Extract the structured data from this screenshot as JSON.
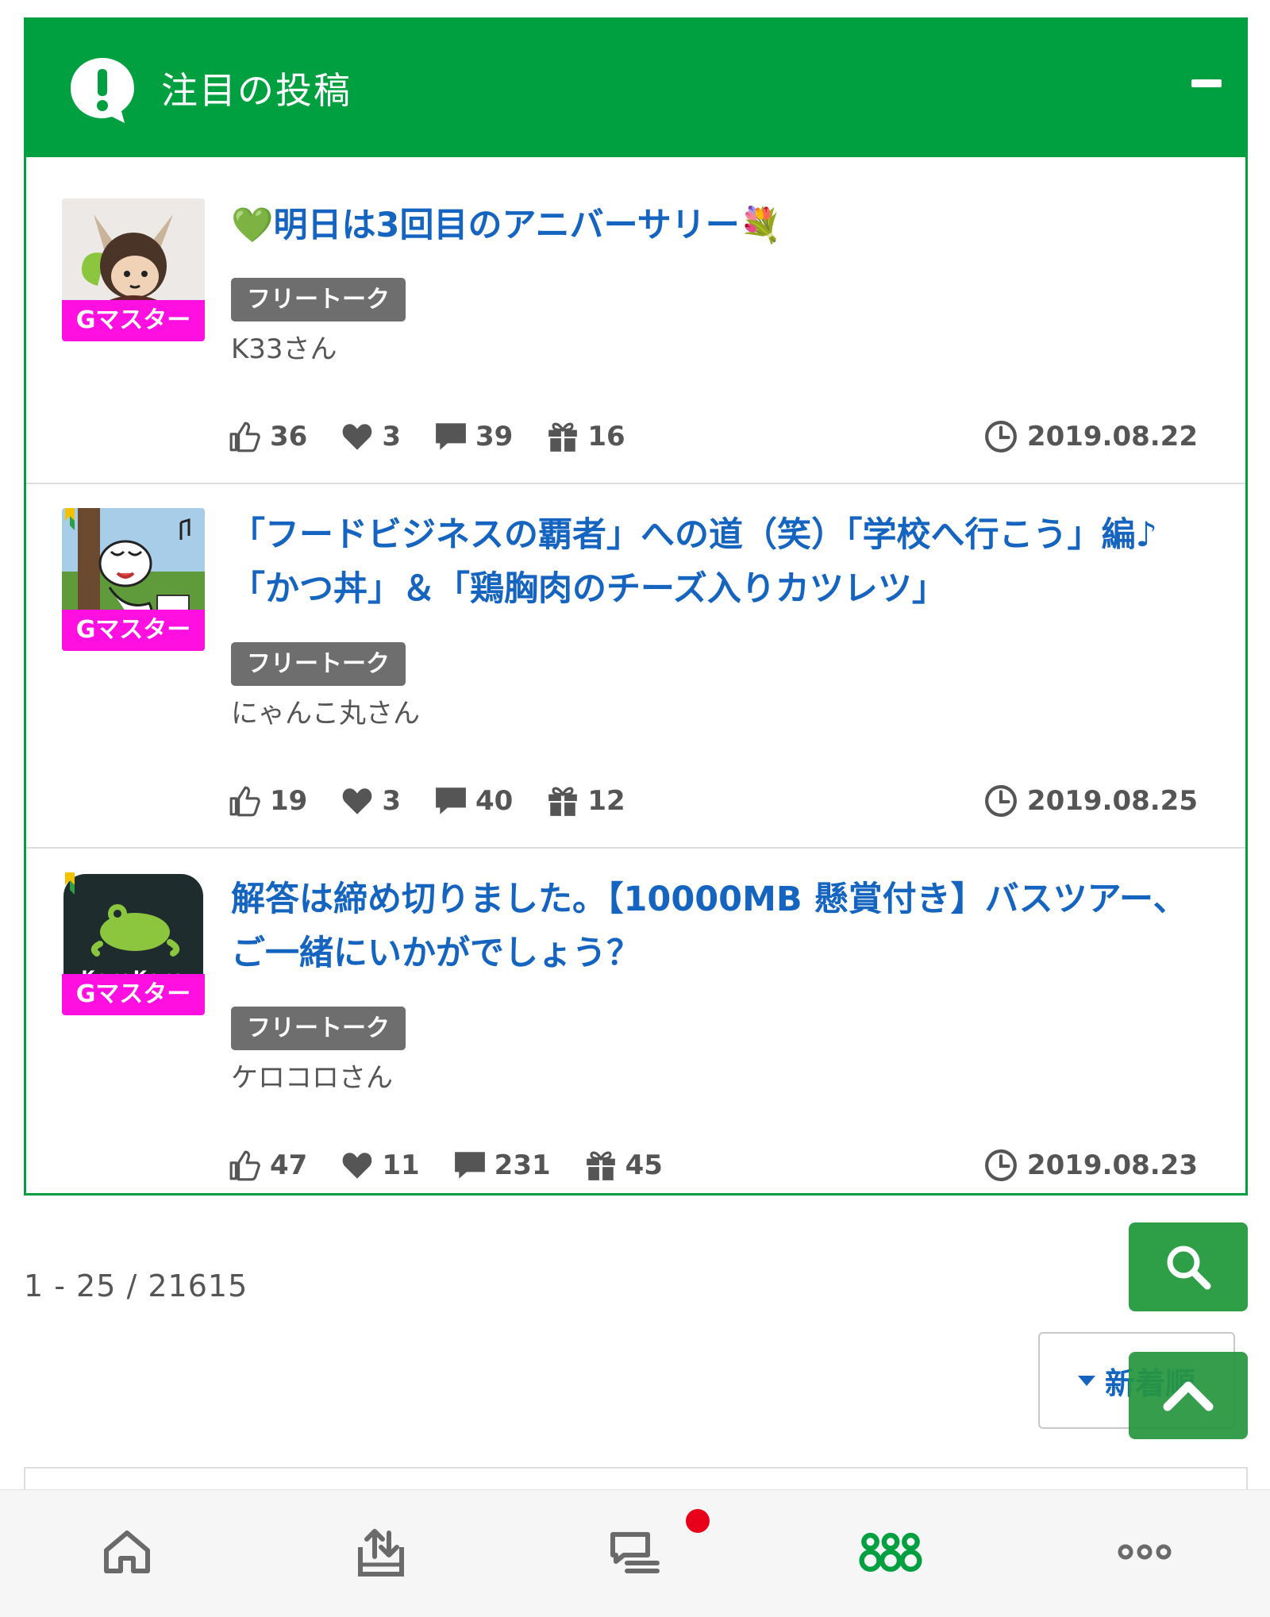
{
  "header": {
    "title": "注目の投稿"
  },
  "posts": [
    {
      "title": "💚明日は3回目のアニバーサリー💐",
      "badge": "Gマスター",
      "category": "フリートーク",
      "author": "K33さん",
      "likes": "36",
      "favorites": "3",
      "comments": "39",
      "gifts": "16",
      "date": "2019.08.22"
    },
    {
      "title": "「フードビジネスの覇者」への道（笑）「学校へ行こう」編♪「かつ丼」＆「鶏胸肉のチーズ入りカツレツ」",
      "badge": "Gマスター",
      "category": "フリートーク",
      "author": "にゃんこ丸さん",
      "likes": "19",
      "favorites": "3",
      "comments": "40",
      "gifts": "12",
      "date": "2019.08.25"
    },
    {
      "title": "解答は締め切りました。【10000MB 懸賞付き】バスツアー、ご一緒にいかがでしょう？",
      "badge": "Gマスター",
      "avatar_text": "KeroKoro",
      "category": "フリートーク",
      "author": "ケロコロさん",
      "likes": "47",
      "favorites": "11",
      "comments": "231",
      "gifts": "45",
      "date": "2019.08.23"
    }
  ],
  "pagination": {
    "range": "1 - 25 / 21615"
  },
  "sort": {
    "label": "新着順"
  },
  "icons": {
    "header": "exclamation-bubble-icon",
    "collapse": "minus-icon",
    "like": "thumbs-up-icon",
    "favorite": "heart-icon",
    "comment": "comment-icon",
    "gift": "gift-icon",
    "date": "clock-icon",
    "search": "search-icon",
    "top": "chevron-up-icon",
    "tabs": [
      "home-icon",
      "upload-icon",
      "chat-icon",
      "community-icon",
      "more-icon"
    ]
  },
  "colors": {
    "brand": "#00a040",
    "link": "#1565c0",
    "badge": "#ff10e0",
    "tag": "#6e6e6e",
    "notice": "#e8001a"
  }
}
